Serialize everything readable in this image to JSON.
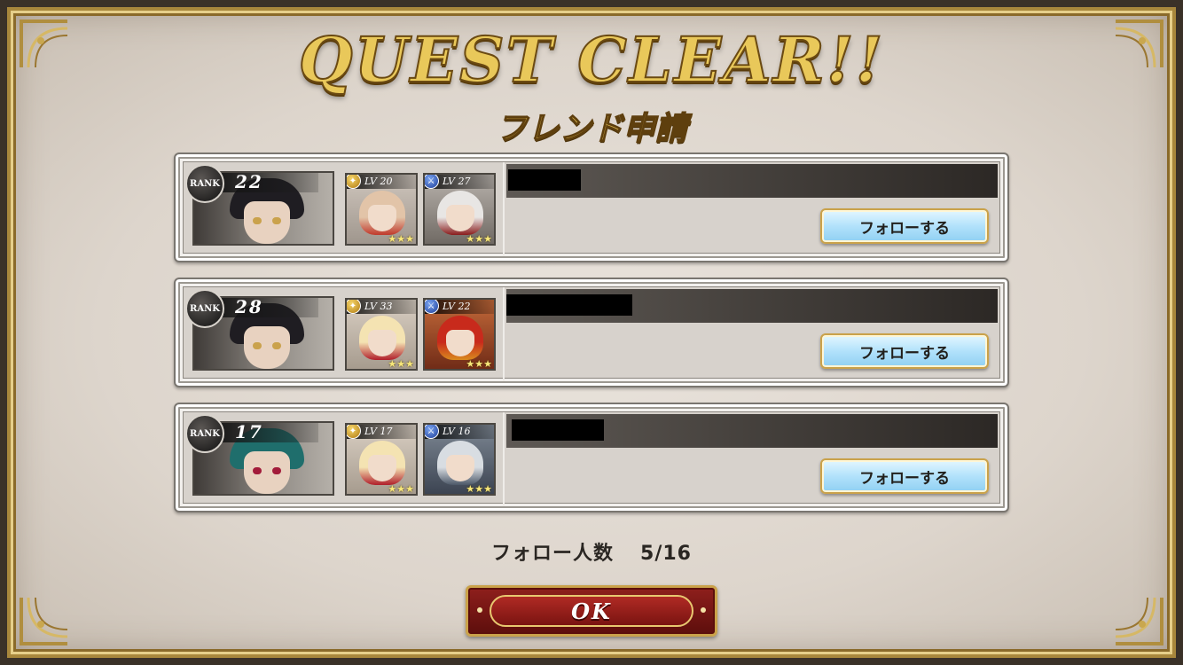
{
  "dialog": {
    "title": "QUEST CLEAR!!",
    "subtitle": "フレンド申請"
  },
  "friends": [
    {
      "rank_label": "RANK",
      "rank": "22",
      "leader": {
        "hair": "#1f1d22",
        "eye": "#caa24c"
      },
      "units": [
        {
          "type": "gold-staff-icon",
          "lv": "LV 20",
          "stars": "★★★",
          "hair": "#e2c4a8",
          "accent": "#c0392b"
        },
        {
          "type": "blue-sword-icon",
          "lv": "LV 27",
          "stars": "★★★",
          "hair": "#e8e6e4",
          "accent": "#8a1c1c"
        }
      ],
      "name_redacted": true,
      "follow_label": "フォローする"
    },
    {
      "rank_label": "RANK",
      "rank": "28",
      "leader": {
        "hair": "#1f1d22",
        "eye": "#caa24c"
      },
      "units": [
        {
          "type": "gold-staff-icon",
          "lv": "LV 33",
          "stars": "★★★",
          "hair": "#f4e3b2",
          "accent": "#b01e2a"
        },
        {
          "type": "blue-sword-icon",
          "lv": "LV 22",
          "stars": "★★★",
          "hair": "#c82a1c",
          "accent": "#d98a1e"
        }
      ],
      "name_redacted": true,
      "follow_label": "フォローする"
    },
    {
      "rank_label": "RANK",
      "rank": "17",
      "leader": {
        "hair": "#1f6e6c",
        "eye": "#a21b3a"
      },
      "units": [
        {
          "type": "gold-staff-icon",
          "lv": "LV 17",
          "stars": "★★★",
          "hair": "#f4e3b2",
          "accent": "#b01e2a"
        },
        {
          "type": "blue-sword-icon",
          "lv": "LV 16",
          "stars": "★★★",
          "hair": "#d8dde2",
          "accent": "#4c5868"
        }
      ],
      "name_redacted": true,
      "follow_label": "フォローする"
    }
  ],
  "follow_count": {
    "label": "フォロー人数",
    "value": "5/16"
  },
  "ok_button": {
    "label": "OK"
  },
  "colors": {
    "frame_gold": "#a8873c",
    "follow_button": "#b2e2fb",
    "ok_button": "#8e1f1c"
  }
}
